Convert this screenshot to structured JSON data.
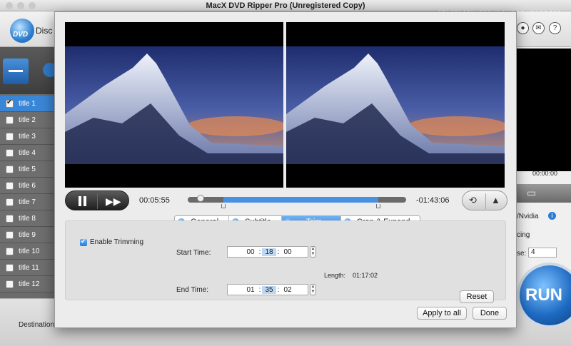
{
  "window": {
    "title": "MacX DVD Ripper Pro (Unregistered Copy)",
    "watermark": "www.macib.com"
  },
  "toolbar": {
    "logo_text": "DVD",
    "disc_label": "Disc",
    "icons": [
      "user-icon",
      "mail-icon",
      "help-icon"
    ],
    "help_glyph": "?"
  },
  "title_list": [
    {
      "label": "title 1",
      "checked": true
    },
    {
      "label": "title 2",
      "checked": false
    },
    {
      "label": "title 3",
      "checked": false
    },
    {
      "label": "title 4",
      "checked": false
    },
    {
      "label": "title 5",
      "checked": false
    },
    {
      "label": "title 6",
      "checked": false
    },
    {
      "label": "title 7",
      "checked": false
    },
    {
      "label": "title 8",
      "checked": false
    },
    {
      "label": "title 9",
      "checked": false
    },
    {
      "label": "title 10",
      "checked": false
    },
    {
      "label": "title 11",
      "checked": false
    },
    {
      "label": "title 12",
      "checked": false
    }
  ],
  "right_panel": {
    "time": "00:00:00",
    "nvidia": "/Nvidia",
    "info_icon": "i",
    "cing": "cing",
    "se_label": "se:",
    "se_value": "4"
  },
  "run_button": {
    "label": "RUN"
  },
  "bottom": {
    "destination_label": "Destination"
  },
  "player": {
    "current_time": "00:05:55",
    "remaining_time": "-01:43:06",
    "play_icon": "pause-icon",
    "ff_glyph": "▶▶"
  },
  "tabs": [
    {
      "label": "General",
      "active": false
    },
    {
      "label": "Subtitle",
      "active": false
    },
    {
      "label": "Trim",
      "active": true
    },
    {
      "label": "Crop & Expand",
      "active": false
    }
  ],
  "trim": {
    "enable_label": "Enable Trimming",
    "enabled": true,
    "start_label": "Start Time:",
    "start": {
      "h": "00",
      "m": "18",
      "s": "00"
    },
    "end_label": "End Time:",
    "end": {
      "h": "01",
      "m": "35",
      "s": "02"
    },
    "length_label": "Length:",
    "length_value": "01:17:02",
    "reset_label": "Reset"
  },
  "dialog_buttons": {
    "apply_all": "Apply to all",
    "done": "Done"
  },
  "colors": {
    "accent": "#3a86d6",
    "sky_top": "#2b3d8a",
    "sky_bottom": "#d98a5a"
  }
}
